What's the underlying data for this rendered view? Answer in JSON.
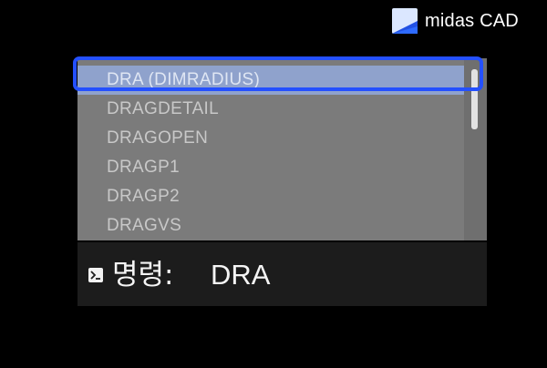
{
  "brand": {
    "name": "midas CAD",
    "logo_icon": "midas-logo-icon"
  },
  "autocomplete": {
    "items": [
      {
        "label": "DRA (DIMRADIUS)",
        "selected": true
      },
      {
        "label": "DRAGDETAIL",
        "selected": false
      },
      {
        "label": "DRAGOPEN",
        "selected": false
      },
      {
        "label": "DRAGP1",
        "selected": false
      },
      {
        "label": "DRAGP2",
        "selected": false
      },
      {
        "label": "DRAGVS",
        "selected": false
      }
    ]
  },
  "command_line": {
    "icon": "terminal-prompt-icon",
    "label": "명령:",
    "value": "DRA"
  },
  "colors": {
    "highlight_border": "#2450ff",
    "selected_item_bg": "#8fa2cc",
    "list_bg": "#7b7b7b",
    "command_bar_bg": "#1c1c1c"
  }
}
